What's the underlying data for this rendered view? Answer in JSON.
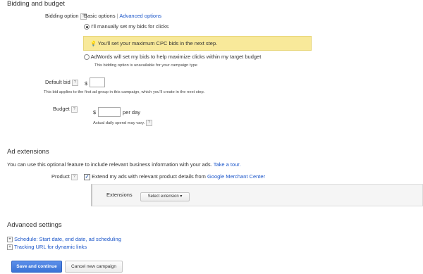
{
  "bidding": {
    "title": "Bidding and budget",
    "option_label": "Bidding option",
    "help": "?",
    "basic_options": "Basic options",
    "separator": "|",
    "advanced_options": "Advanced options",
    "manual_label": "I'll manually set my bids for clicks",
    "manual_selected": true,
    "warning_text": "You'll set your maximum CPC bids in the next step.",
    "auto_label": "AdWords will set my bids to help maximize clicks within my target budget",
    "auto_note": "This bidding option is unavailable for your campaign type",
    "default_bid_label": "Default bid",
    "currency": "$",
    "default_bid_value": "",
    "default_bid_note": "This bid applies to the first ad group in this campaign, which you'll create in the next step.",
    "budget_label": "Budget",
    "budget_value": "",
    "per_day": "per day",
    "budget_note": "Actual daily spend may vary."
  },
  "ad_extensions": {
    "title": "Ad extensions",
    "intro": "You can use this optional feature to include relevant business information with your ads.",
    "tour_link": "Take a tour.",
    "product_label": "Product",
    "product_checked": true,
    "product_text": "Extend my ads with relevant product details from",
    "gmc_link": "Google Merchant Center",
    "extensions_label": "Extensions",
    "select_extension": "Select extension"
  },
  "advanced": {
    "title": "Advanced settings",
    "schedule_link": "Schedule: Start date, end date, ad scheduling",
    "tracking_link": "Tracking URL for dynamic links"
  },
  "actions": {
    "save_label": "Save and continue",
    "cancel_label": "Cancel new campaign"
  },
  "colors": {
    "link": "#1a55c9",
    "warning_bg": "#f8e99a",
    "primary_button": "#3b73d6"
  }
}
